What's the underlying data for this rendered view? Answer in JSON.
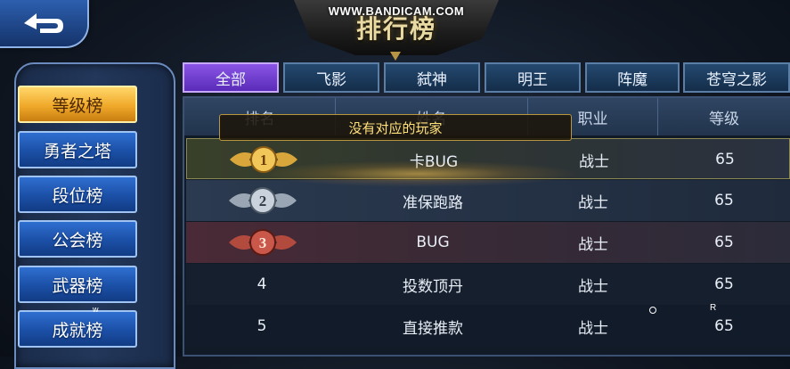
{
  "header": {
    "watermark": "WWW.BANDICAM.COM",
    "title": "排行榜",
    "back_icon": "back-arrow-icon"
  },
  "sidebar": {
    "items": [
      {
        "label": "等级榜",
        "active": true
      },
      {
        "label": "勇者之塔",
        "active": false
      },
      {
        "label": "段位榜",
        "active": false
      },
      {
        "label": "公会榜",
        "active": false
      },
      {
        "label": "武器榜",
        "active": false
      },
      {
        "label": "成就榜",
        "active": false
      }
    ],
    "overlay_letter": "w"
  },
  "tabs": [
    {
      "label": "全部",
      "active": true
    },
    {
      "label": "飞影",
      "active": false
    },
    {
      "label": "弑神",
      "active": false
    },
    {
      "label": "明王",
      "active": false
    },
    {
      "label": "阵魔",
      "active": false
    },
    {
      "label": "苍穹之影",
      "active": false
    }
  ],
  "table": {
    "headers": [
      "排名",
      "姓名",
      "职业",
      "等级"
    ],
    "notice": "没有对应的玩家",
    "rows": [
      {
        "rank": "1",
        "name": "卡BUG",
        "class": "战士",
        "level": "65"
      },
      {
        "rank": "2",
        "name": "准保跑路",
        "class": "战士",
        "level": "65"
      },
      {
        "rank": "3",
        "name": "BUG",
        "class": "战士",
        "level": "65"
      },
      {
        "rank": "4",
        "name": "投数顶丹",
        "class": "战士",
        "level": "65"
      },
      {
        "rank": "5",
        "name": "直接推款",
        "class": "战士",
        "level": "65"
      }
    ]
  },
  "overlay_marks": {
    "r": "R"
  },
  "colors": {
    "active_side": "#f0a92a",
    "active_tab": "#7443d4",
    "gold": "#e7b64a",
    "silver": "#b8c3cf",
    "bronze": "#c0403a"
  }
}
